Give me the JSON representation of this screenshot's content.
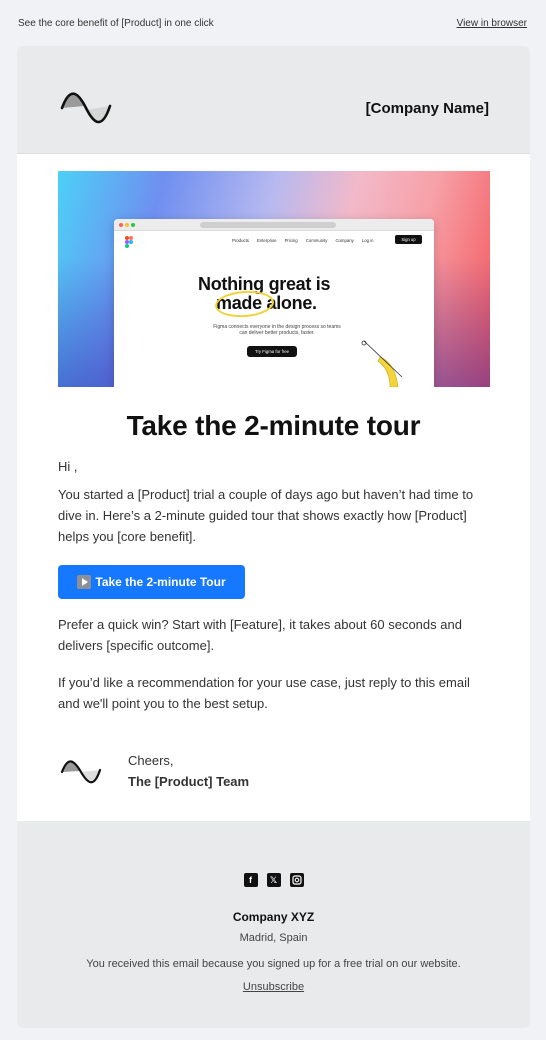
{
  "preheader": {
    "text": "See the core benefit of [Product] in one click",
    "view_in_browser": "View in browser"
  },
  "header": {
    "logo_icon": "sine-wave-logo-icon",
    "company_name": "[Company Name]"
  },
  "hero": {
    "headline_line1": "Nothing great is",
    "headline_line2": "made alone.",
    "subtext": "Figma connects everyone in the design process so teams can deliver better products, faster.",
    "cta": "Try Figma for free",
    "nav_links": [
      "Products",
      "Enterprise",
      "Pricing",
      "Community",
      "Company",
      "Log in"
    ],
    "signup": "Sign up",
    "url": "figma.com"
  },
  "content": {
    "title": "Take the 2-minute tour",
    "greeting": "Hi ,",
    "paragraph1": "You started a [Product] trial a couple of days ago but haven’t had time to dive in. Here’s a 2-minute guided tour that shows exactly how [Product] helps you [core benefit].",
    "cta_label": "Take the 2-minute Tour",
    "cta_icon": "play-button-icon",
    "paragraph2": "Prefer a quick win? Start with [Feature], it takes about 60 seconds and delivers [specific outcome].",
    "paragraph3": "If you’d like a recommendation for your use case, just reply to this email and we'll point you to the best setup."
  },
  "signature": {
    "closing": "Cheers,",
    "team": "The [Product] Team"
  },
  "footer": {
    "socials": [
      "facebook-icon",
      "x-icon",
      "instagram-icon"
    ],
    "company": "Company XYZ",
    "location": "Madrid, Spain",
    "note": "You received this email because you signed up for a free trial on our website.",
    "unsubscribe": "Unsubscribe"
  },
  "colors": {
    "background": "#f0f2f5",
    "header_bg": "#e9eaec",
    "cta_blue": "#1677ff",
    "text": "#333333"
  }
}
